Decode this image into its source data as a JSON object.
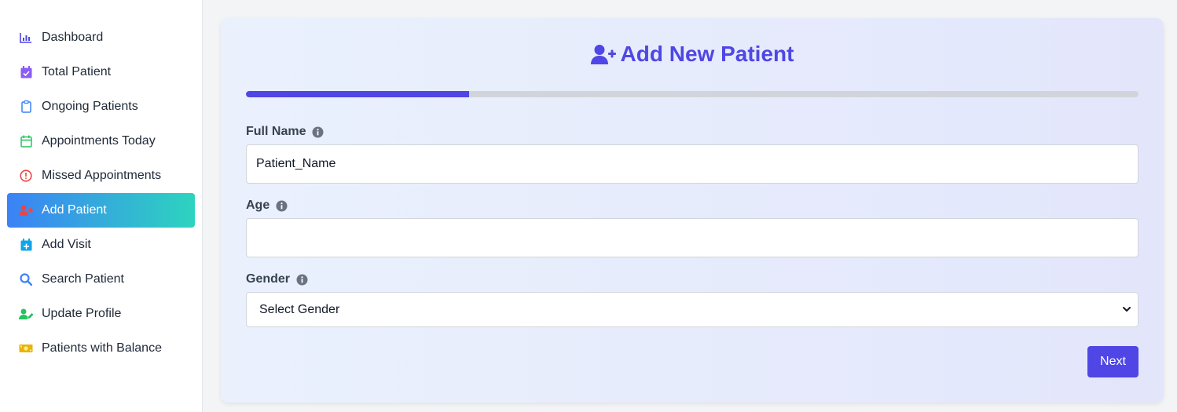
{
  "sidebar": {
    "items": [
      {
        "label": "Dashboard",
        "icon": "chart-bar-icon",
        "color": "#4f46e5"
      },
      {
        "label": "Total Patient",
        "icon": "calendar-check-icon",
        "color": "#8b5cf6"
      },
      {
        "label": "Ongoing Patients",
        "icon": "clipboard-icon",
        "color": "#3b82f6"
      },
      {
        "label": "Appointments Today",
        "icon": "calendar-icon",
        "color": "#22c55e"
      },
      {
        "label": "Missed Appointments",
        "icon": "exclamation-circle-icon",
        "color": "#ef4444"
      },
      {
        "label": "Add Patient",
        "icon": "user-plus-icon",
        "color": "#ef4444",
        "active": true
      },
      {
        "label": "Add Visit",
        "icon": "calendar-plus-icon",
        "color": "#0ea5e9"
      },
      {
        "label": "Search Patient",
        "icon": "search-icon",
        "color": "#3b82f6"
      },
      {
        "label": "Update Profile",
        "icon": "user-edit-icon",
        "color": "#22c55e"
      },
      {
        "label": "Patients with Balance",
        "icon": "money-bill-icon",
        "color": "#eab308"
      }
    ]
  },
  "form": {
    "title": "Add New Patient",
    "title_icon": "user-plus-icon",
    "progress_fraction": 0.25,
    "fields": {
      "full_name": {
        "label": "Full Name",
        "value": "Patient_Name"
      },
      "age": {
        "label": "Age",
        "value": ""
      },
      "gender": {
        "label": "Gender",
        "selected": "Select Gender"
      }
    },
    "next_label": "Next"
  },
  "colors": {
    "accent": "#4f46e5",
    "active_gradient_start": "#3b82f6",
    "active_gradient_end": "#2dd4bf"
  }
}
